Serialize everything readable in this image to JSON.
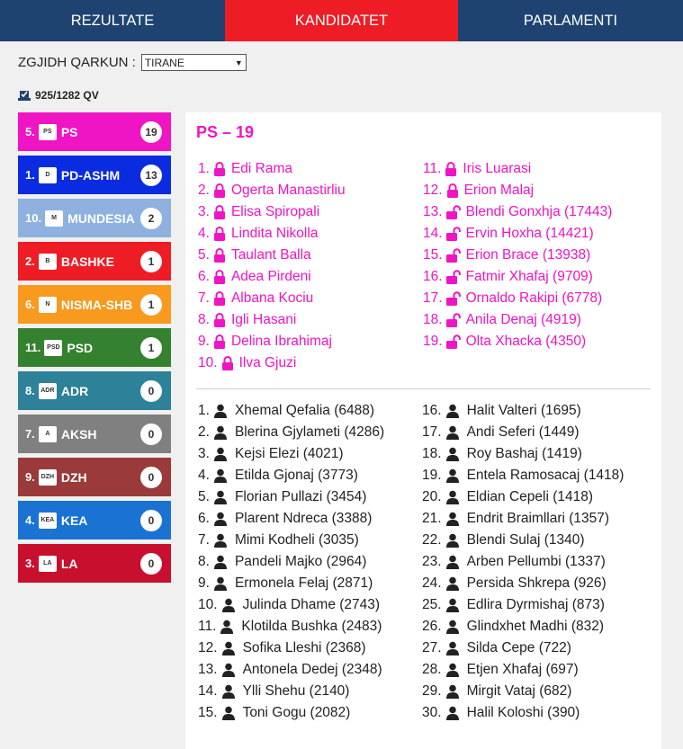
{
  "nav": {
    "tabs": [
      {
        "label": "REZULTATE",
        "active": false
      },
      {
        "label": "KANDIDATET",
        "active": true
      },
      {
        "label": "PARLAMENTI",
        "active": false
      }
    ]
  },
  "filter": {
    "label": "ZGJIDH QARKUN :",
    "selected": "TIRANE"
  },
  "vote_count": "925/1282 QV",
  "parties": [
    {
      "num": "5.",
      "name": "PS",
      "seats": "19",
      "color": "#ef14c4",
      "logo": "PS"
    },
    {
      "num": "1.",
      "name": "PD-ASHM",
      "seats": "13",
      "color": "#0b2be0",
      "logo": "D"
    },
    {
      "num": "10.",
      "name": "MUNDESIA",
      "seats": "2",
      "color": "#8eb1e0",
      "logo": "M"
    },
    {
      "num": "2.",
      "name": "BASHKE",
      "seats": "1",
      "color": "#ee1c25",
      "logo": "B"
    },
    {
      "num": "6.",
      "name": "NISMA-SHB",
      "seats": "1",
      "color": "#f79a1e",
      "logo": "N"
    },
    {
      "num": "11.",
      "name": "PSD",
      "seats": "1",
      "color": "#34812f",
      "logo": "PSD"
    },
    {
      "num": "8.",
      "name": "ADR",
      "seats": "0",
      "color": "#2d8198",
      "logo": "ADR"
    },
    {
      "num": "7.",
      "name": "AKSH",
      "seats": "0",
      "color": "#808080",
      "logo": "A"
    },
    {
      "num": "9.",
      "name": "DZH",
      "seats": "0",
      "color": "#9b3a3a",
      "logo": "DZH"
    },
    {
      "num": "4.",
      "name": "KEA",
      "seats": "0",
      "color": "#1a73d3",
      "logo": "KEA"
    },
    {
      "num": "3.",
      "name": "LA",
      "seats": "0",
      "color": "#c8102e",
      "logo": "LA"
    }
  ],
  "detail": {
    "title": "PS – 19",
    "elected_left": [
      {
        "n": "1.",
        "name": "Edi Rama",
        "locked": true
      },
      {
        "n": "2.",
        "name": "Ogerta Manastirliu",
        "locked": true
      },
      {
        "n": "3.",
        "name": "Elisa Spiropali",
        "locked": true
      },
      {
        "n": "4.",
        "name": "Lindita Nikolla",
        "locked": true
      },
      {
        "n": "5.",
        "name": "Taulant Balla",
        "locked": true
      },
      {
        "n": "6.",
        "name": "Adea Pirdeni",
        "locked": true
      },
      {
        "n": "7.",
        "name": "Albana Kociu",
        "locked": true
      },
      {
        "n": "8.",
        "name": "Igli Hasani",
        "locked": true
      },
      {
        "n": "9.",
        "name": "Delina Ibrahimaj",
        "locked": true
      },
      {
        "n": "10.",
        "name": "Ilva Gjuzi",
        "locked": true
      }
    ],
    "elected_right": [
      {
        "n": "11.",
        "name": "Iris Luarasi",
        "locked": true
      },
      {
        "n": "12.",
        "name": "Erion Malaj",
        "locked": true
      },
      {
        "n": "13.",
        "name": "Blendi Gonxhja (17443)",
        "locked": false
      },
      {
        "n": "14.",
        "name": "Ervin Hoxha (14421)",
        "locked": false
      },
      {
        "n": "15.",
        "name": "Erion Brace (13938)",
        "locked": false
      },
      {
        "n": "16.",
        "name": "Fatmir Xhafaj (9709)",
        "locked": false
      },
      {
        "n": "17.",
        "name": "Ornaldo Rakipi (6778)",
        "locked": false
      },
      {
        "n": "18.",
        "name": "Anila Denaj (4919)",
        "locked": false
      },
      {
        "n": "19.",
        "name": "Olta Xhacka (4350)",
        "locked": false
      }
    ],
    "others_left": [
      {
        "n": "1.",
        "name": "Xhemal Qefalia (6488)"
      },
      {
        "n": "2.",
        "name": "Blerina Gjylameti (4286)"
      },
      {
        "n": "3.",
        "name": "Kejsi Elezi (4021)"
      },
      {
        "n": "4.",
        "name": "Etilda Gjonaj (3773)"
      },
      {
        "n": "5.",
        "name": "Florian Pullazi (3454)"
      },
      {
        "n": "6.",
        "name": "Plarent Ndreca (3388)"
      },
      {
        "n": "7.",
        "name": "Mimi Kodheli (3035)"
      },
      {
        "n": "8.",
        "name": "Pandeli Majko (2964)"
      },
      {
        "n": "9.",
        "name": "Ermonela Felaj (2871)"
      },
      {
        "n": "10.",
        "name": "Julinda Dhame (2743)"
      },
      {
        "n": "11.",
        "name": "Klotilda Bushka (2483)"
      },
      {
        "n": "12.",
        "name": "Sofika Lleshi (2368)"
      },
      {
        "n": "13.",
        "name": "Antonela Dedej (2348)"
      },
      {
        "n": "14.",
        "name": "Ylli Shehu (2140)"
      },
      {
        "n": "15.",
        "name": "Toni Gogu (2082)"
      }
    ],
    "others_right": [
      {
        "n": "16.",
        "name": "Halit Valteri (1695)"
      },
      {
        "n": "17.",
        "name": "Andi Seferi (1449)"
      },
      {
        "n": "18.",
        "name": "Roy Bashaj (1419)"
      },
      {
        "n": "19.",
        "name": "Entela Ramosacaj (1418)"
      },
      {
        "n": "20.",
        "name": "Eldian Cepeli (1418)"
      },
      {
        "n": "21.",
        "name": "Endrit Braimllari (1357)"
      },
      {
        "n": "22.",
        "name": "Blendi Sulaj (1340)"
      },
      {
        "n": "23.",
        "name": "Arben Pellumbi (1337)"
      },
      {
        "n": "24.",
        "name": "Persida Shkrepa (926)"
      },
      {
        "n": "25.",
        "name": "Edlira Dyrmishaj (873)"
      },
      {
        "n": "26.",
        "name": "Glindxhet Madhi (832)"
      },
      {
        "n": "27.",
        "name": "Silda Cepe (722)"
      },
      {
        "n": "28.",
        "name": "Etjen Xhafaj (697)"
      },
      {
        "n": "29.",
        "name": "Mirgit Vataj (682)"
      },
      {
        "n": "30.",
        "name": "Halil Koloshi (390)"
      }
    ]
  }
}
